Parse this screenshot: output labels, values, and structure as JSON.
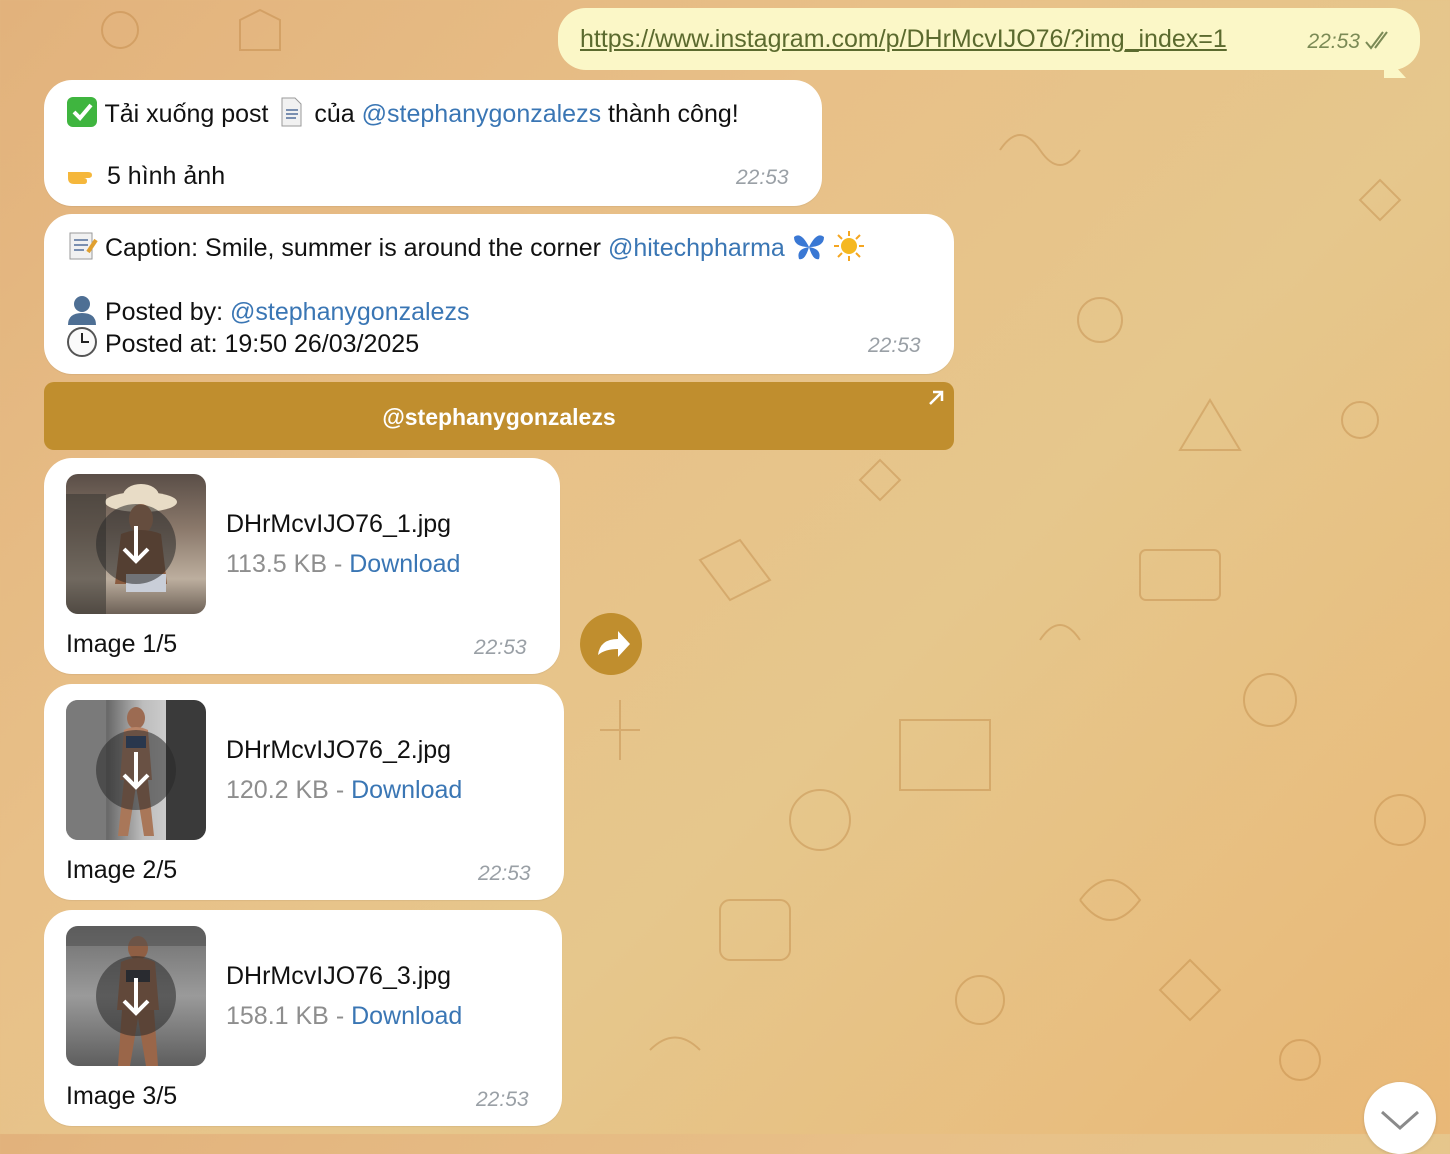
{
  "outgoing": {
    "url": "https://www.instagram.com/p/DHrMcvIJO76/?img_index=1",
    "time": "22:53"
  },
  "msg1": {
    "line1_prefix": "Tải xuống post",
    "line1_middle": "của",
    "line1_mention": "@stephanygonzalezs",
    "line1_suffix": "thành công!",
    "line2": "5 hình ảnh",
    "time": "22:53"
  },
  "msg2": {
    "caption_prefix": "Caption: Smile, summer is around the corner",
    "caption_mention": "@hitechpharma",
    "posted_by_label": "Posted by:",
    "posted_by_mention": "@stephanygonzalezs",
    "posted_at": "Posted at: 19:50 26/03/2025",
    "time": "22:53"
  },
  "banner": {
    "label": "@stephanygonzalezs"
  },
  "files": [
    {
      "name": "DHrMcvIJO76_1.jpg",
      "size": "113.5 KB",
      "sep": "-",
      "download": "Download",
      "label": "Image 1/5",
      "time": "22:53"
    },
    {
      "name": "DHrMcvIJO76_2.jpg",
      "size": "120.2 KB",
      "sep": "-",
      "download": "Download",
      "label": "Image 2/5",
      "time": "22:53"
    },
    {
      "name": "DHrMcvIJO76_3.jpg",
      "size": "158.1 KB",
      "sep": "-",
      "download": "Download",
      "label": "Image 3/5",
      "time": "22:53"
    }
  ],
  "colors": {
    "accent": "#c08e2e",
    "link": "#3a76b4",
    "outgoing_bg": "#fbf7c7"
  },
  "icons": [
    "check-icon",
    "document-icon",
    "pointing-hand-icon",
    "memo-icon",
    "butterfly-icon",
    "sun-icon",
    "user-icon",
    "clock-icon",
    "download-icon",
    "share-icon",
    "chevron-down-icon",
    "external-arrow-icon"
  ]
}
